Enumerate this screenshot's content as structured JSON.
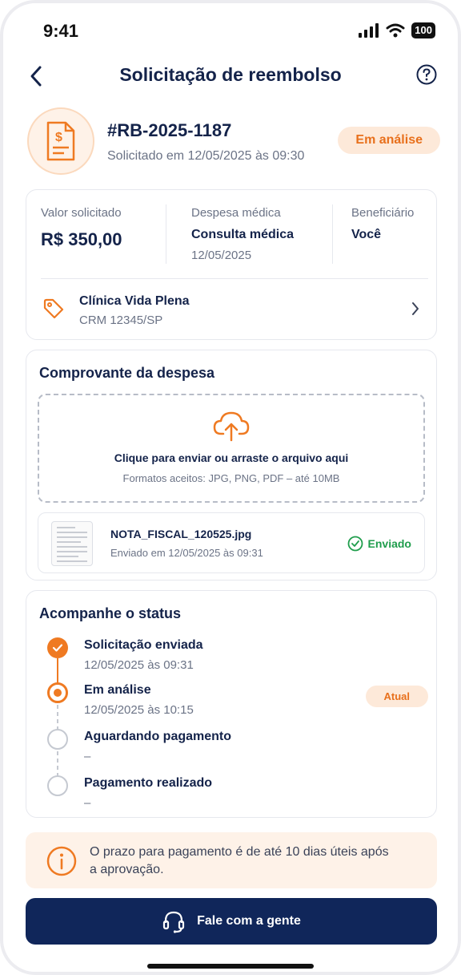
{
  "status_bar": {
    "time": "9:41",
    "battery": "100"
  },
  "nav": {
    "title": "Solicitação de reembolso",
    "back_icon": "chevron-left-icon",
    "help_icon": "help-circle-icon"
  },
  "request": {
    "id": "#RB-2025-1187",
    "requested_on": "Solicitado em 12/05/2025 às 09:30",
    "status_badge": "Em análise",
    "icon": "receipt-dollar-icon"
  },
  "summary": {
    "amount_label": "Valor solicitado",
    "amount_value": "R$ 350,00",
    "expense_label": "Despesa médica",
    "expense_value": "Consulta médica",
    "expense_date": "12/05/2025",
    "beneficiary_label": "Beneficiário",
    "beneficiary_value": "Você"
  },
  "provider": {
    "name": "Clínica Vida Plena",
    "crm": "CRM 12345/SP",
    "icon": "tag-icon"
  },
  "receipt": {
    "section_title": "Comprovante da despesa",
    "upload_title": "Clique para enviar ou arraste o arquivo aqui",
    "upload_formats": "Formatos aceitos: JPG, PNG, PDF – até 10MB",
    "file_name": "NOTA_FISCAL_120525.jpg",
    "file_date": "Enviado em 12/05/2025 às 09:31",
    "file_status": "Enviado"
  },
  "tracking": {
    "section_title": "Acompanhe o status",
    "current_badge": "Atual",
    "steps": [
      {
        "title": "Solicitação enviada",
        "date": "12/05/2025 às 09:31",
        "state": "done"
      },
      {
        "title": "Em análise",
        "date": "12/05/2025 às 10:15",
        "state": "current"
      },
      {
        "title": "Aguardando pagamento",
        "date": "–",
        "state": "pending"
      },
      {
        "title": "Pagamento realizado",
        "date": "–",
        "state": "pending"
      }
    ]
  },
  "notice": {
    "text": "O prazo para pagamento é de até 10 dias úteis após a aprovação.",
    "icon": "info-circle-icon"
  },
  "cta": {
    "label": "Fale com a gente",
    "icon": "headset-icon"
  },
  "colors": {
    "primary": "#10265a",
    "accent": "#ef7a22",
    "success": "#1f9d4c",
    "muted": "#6b7386"
  }
}
